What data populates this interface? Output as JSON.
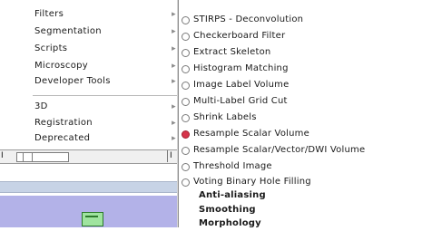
{
  "parent_menu": {
    "items": [
      {
        "label": "Filters",
        "arrow": "▸"
      },
      {
        "label": "Segmentation",
        "arrow": "▸"
      },
      {
        "label": "Scripts",
        "arrow": "▸"
      },
      {
        "label": "Microscopy",
        "arrow": "▸"
      },
      {
        "label": "Developer Tools",
        "arrow": "▸"
      },
      {
        "label": "3D",
        "arrow": "▸"
      },
      {
        "label": "Registration",
        "arrow": "▸"
      },
      {
        "label": "Deprecated",
        "arrow": "▸"
      }
    ]
  },
  "ruler": {
    "label": "I",
    "end_label": "I"
  },
  "submenu": {
    "items": [
      {
        "label": "STIRPS - Deconvolution",
        "radio": true,
        "selected": false
      },
      {
        "label": "Checkerboard Filter",
        "radio": true,
        "selected": false
      },
      {
        "label": "Extract Skeleton",
        "radio": true,
        "selected": false
      },
      {
        "label": "Histogram Matching",
        "radio": true,
        "selected": false
      },
      {
        "label": "Image Label Volume",
        "radio": true,
        "selected": false
      },
      {
        "label": "Multi-Label Grid Cut",
        "radio": true,
        "selected": false
      },
      {
        "label": "Shrink Labels",
        "radio": true,
        "selected": false
      },
      {
        "label": "Resample Scalar Volume",
        "radio": true,
        "selected": true
      },
      {
        "label": "Resample Scalar/Vector/DWI Volume",
        "radio": true,
        "selected": false
      },
      {
        "label": "Threshold Image",
        "radio": true,
        "selected": false
      },
      {
        "label": "Voting Binary Hole Filling",
        "radio": true,
        "selected": false
      },
      {
        "label": "Anti-aliasing",
        "radio": false,
        "selected": false
      },
      {
        "label": "Smoothing",
        "radio": false,
        "selected": false
      },
      {
        "label": "Morphology",
        "radio": false,
        "selected": false
      }
    ]
  },
  "colors": {
    "selected_radio": "#d6344b",
    "thumbnail_bg": "#b3b2e8",
    "strip_bg": "#c7d3e6"
  }
}
